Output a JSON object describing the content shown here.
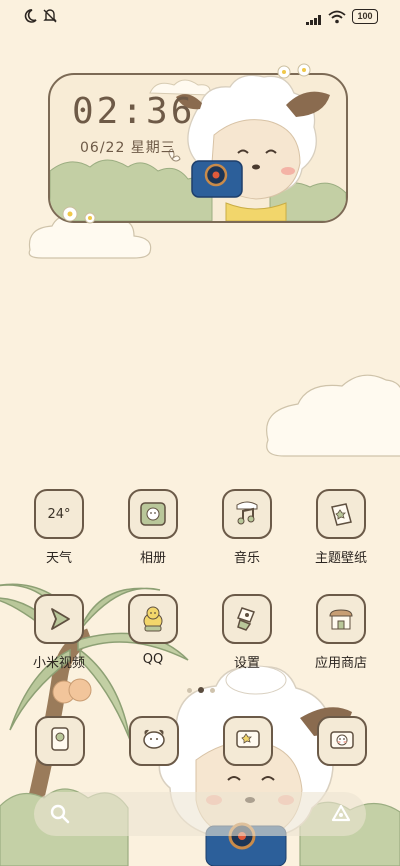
{
  "status_bar": {
    "battery": "100"
  },
  "clock_widget": {
    "time": "02:36",
    "date": "06/22 星期三"
  },
  "apps_row1": [
    {
      "label": "天气",
      "icon": "weather-icon",
      "temp": "24°"
    },
    {
      "label": "相册",
      "icon": "gallery-icon"
    },
    {
      "label": "音乐",
      "icon": "music-icon"
    },
    {
      "label": "主题壁纸",
      "icon": "themes-icon"
    }
  ],
  "apps_row2": [
    {
      "label": "小米视频",
      "icon": "video-icon"
    },
    {
      "label": "QQ",
      "icon": "qq-icon"
    },
    {
      "label": "设置",
      "icon": "settings-icon"
    },
    {
      "label": "应用商店",
      "icon": "app-store-icon"
    }
  ],
  "dock": [
    {
      "icon": "phone-icon"
    },
    {
      "icon": "contacts-icon"
    },
    {
      "icon": "messages-icon"
    },
    {
      "icon": "camera-icon"
    }
  ],
  "page_indicator": {
    "pages": 3,
    "current": 2
  },
  "colors": {
    "background": "#fbf1de",
    "outline": "#6b5a48",
    "foliage": "#b9c79a",
    "wool": "#ffffff"
  }
}
